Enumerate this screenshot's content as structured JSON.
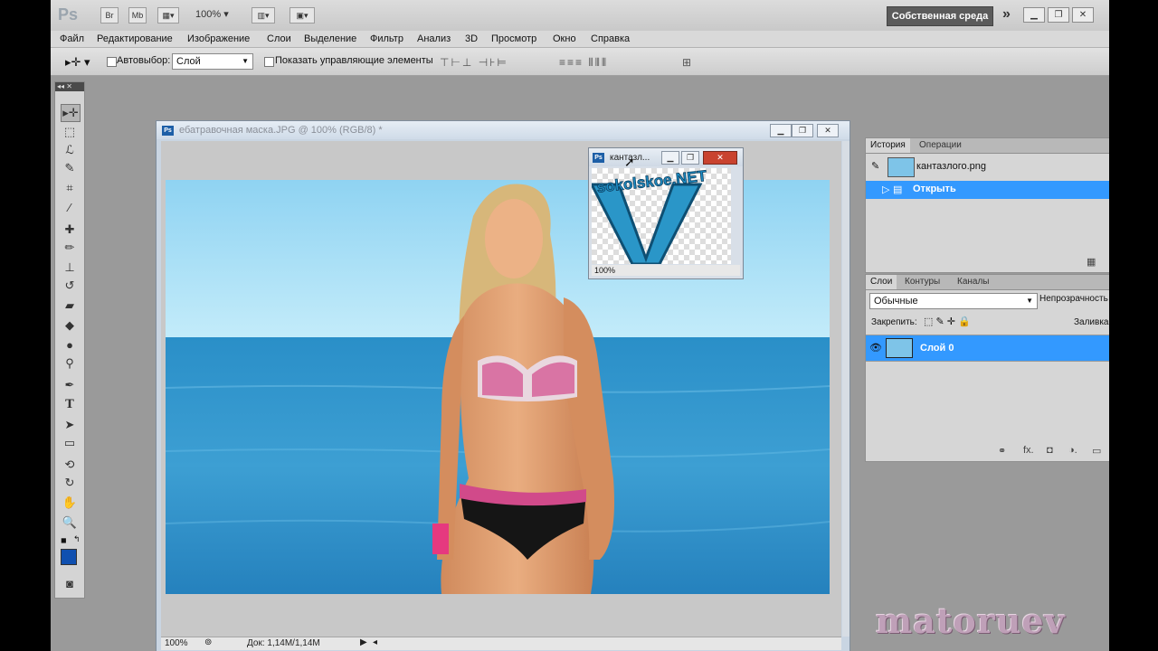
{
  "appbar": {
    "logo": "Ps",
    "br_label": "Br",
    "mb_label": "Mb",
    "zoom": "100%",
    "workspace": "Собственная среда",
    "more": "»"
  },
  "menu": [
    "Файл",
    "Редактирование",
    "Изображение",
    "Слои",
    "Выделение",
    "Фильтр",
    "Анализ",
    "3D",
    "Просмотр",
    "Окно",
    "Справка"
  ],
  "options": {
    "autoselect_label": "Автовыбор:",
    "autoselect_value": "Слой",
    "show_controls_label": "Показать управляющие элементы"
  },
  "document": {
    "title": "ебатравочная маска.JPG @ 100% (RGB/8) *",
    "zoom": "100%",
    "doc_info": "Док: 1,14M/1,14M"
  },
  "subwindow": {
    "title": "кантазл...",
    "zoom": "100%",
    "logo_text": "sokolskoe.NET"
  },
  "history_panel": {
    "tabs": [
      "История",
      "Операции"
    ],
    "items": [
      {
        "label": "кантазлого.png"
      },
      {
        "label": "Открыть"
      }
    ]
  },
  "layers_panel": {
    "tabs": [
      "Слои",
      "Контуры",
      "Каналы"
    ],
    "blend_mode": "Обычные",
    "opacity_label": "Непрозрачность",
    "lock_label": "Закрепить:",
    "fill_label": "Заливка",
    "layers": [
      {
        "name": "Слой 0"
      }
    ]
  },
  "watermark": "matoruev",
  "colors": {
    "selection_blue": "#3399ff",
    "foreground_color": "#1050b0",
    "workspace_button": "#5b5b5b"
  }
}
